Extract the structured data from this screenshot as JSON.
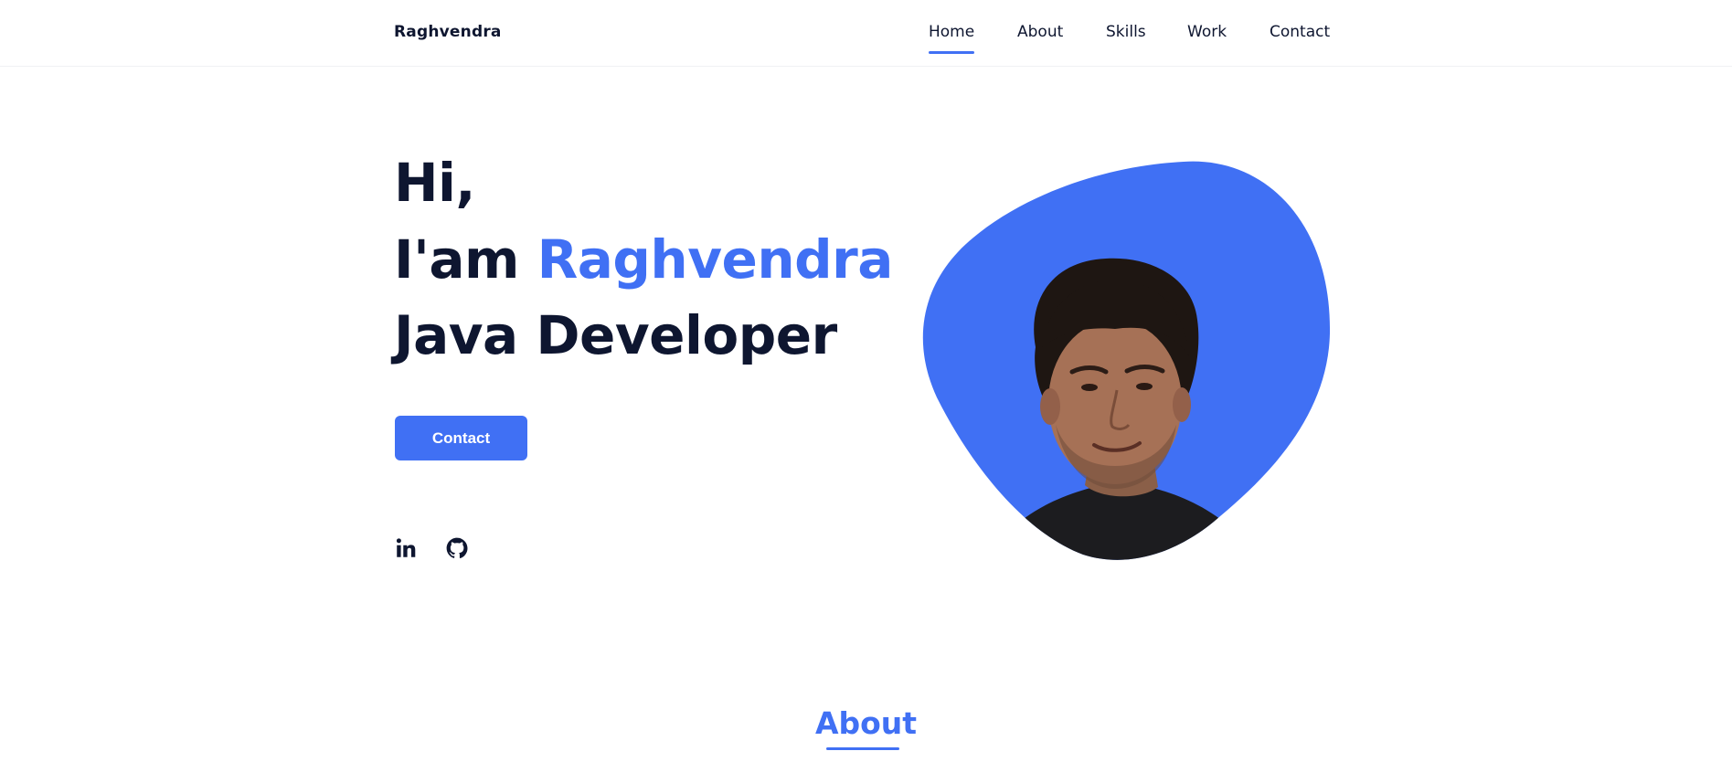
{
  "header": {
    "logo": "Raghvendra",
    "nav": [
      {
        "label": "Home",
        "active": true
      },
      {
        "label": "About",
        "active": false
      },
      {
        "label": "Skills",
        "active": false
      },
      {
        "label": "Work",
        "active": false
      },
      {
        "label": "Contact",
        "active": false
      }
    ]
  },
  "hero": {
    "line1": "Hi,",
    "line2_prefix": "I'am ",
    "line2_name": "Raghvendra",
    "line3": "Java Developer",
    "button_label": "Contact",
    "social": [
      {
        "icon": "linkedin-icon"
      },
      {
        "icon": "github-icon"
      }
    ],
    "image": "profile-photo"
  },
  "about": {
    "title": "About"
  },
  "colors": {
    "accent": "#4070f4",
    "text": "#0e1630",
    "background": "#ffffff"
  }
}
